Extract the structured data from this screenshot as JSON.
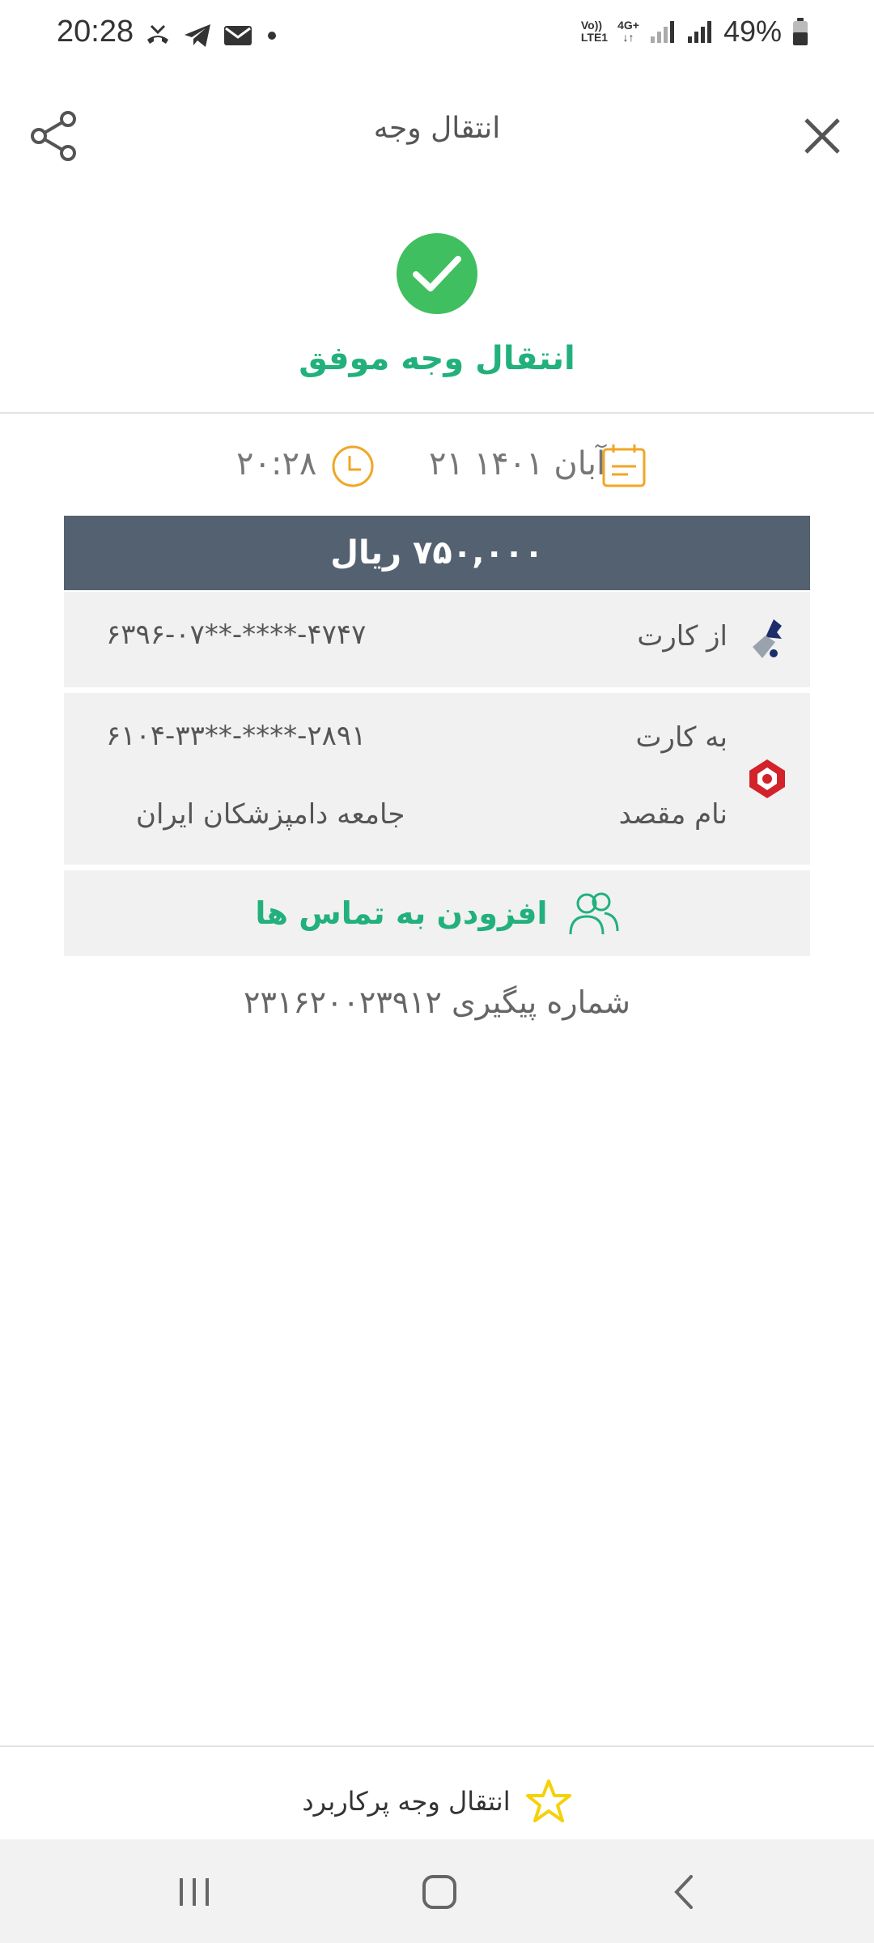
{
  "status_bar": {
    "time": "20:28",
    "battery": "49%",
    "network_label_1": "Vo))",
    "network_label_2": "LTE1",
    "network_label_3": "4G+"
  },
  "header": {
    "title": "انتقال وجه"
  },
  "result": {
    "title": "انتقال وجه موفق"
  },
  "datetime": {
    "date": "۲۱ آبان ۱۴۰۱",
    "time": "۲۰:۲۸"
  },
  "amount": "۷۵۰,۰۰۰ ریال",
  "from_card": {
    "label": "از کارت",
    "number": "۶۳۹۶-۰۷**-****-۴۷۴۷"
  },
  "to_card": {
    "label": "به کارت",
    "number": "۶۱۰۴-۳۳**-****-۲۸۹۱",
    "dest_label": "نام مقصد",
    "dest_name": "جامعه دامپزشکان ایران"
  },
  "contacts": {
    "label": "افزودن به تماس ها"
  },
  "tracking": {
    "text": "شماره پیگیری ۲۳۱۶۲۰۰۲۳۹۱۲"
  },
  "favorites": {
    "label": "انتقال وجه پرکاربرد"
  },
  "colors": {
    "accent_green": "#22b07d",
    "success_circle": "#3fbf5f",
    "amount_bar": "#546170",
    "icon_orange": "#f0a626",
    "star_yellow": "#f5d10a"
  }
}
